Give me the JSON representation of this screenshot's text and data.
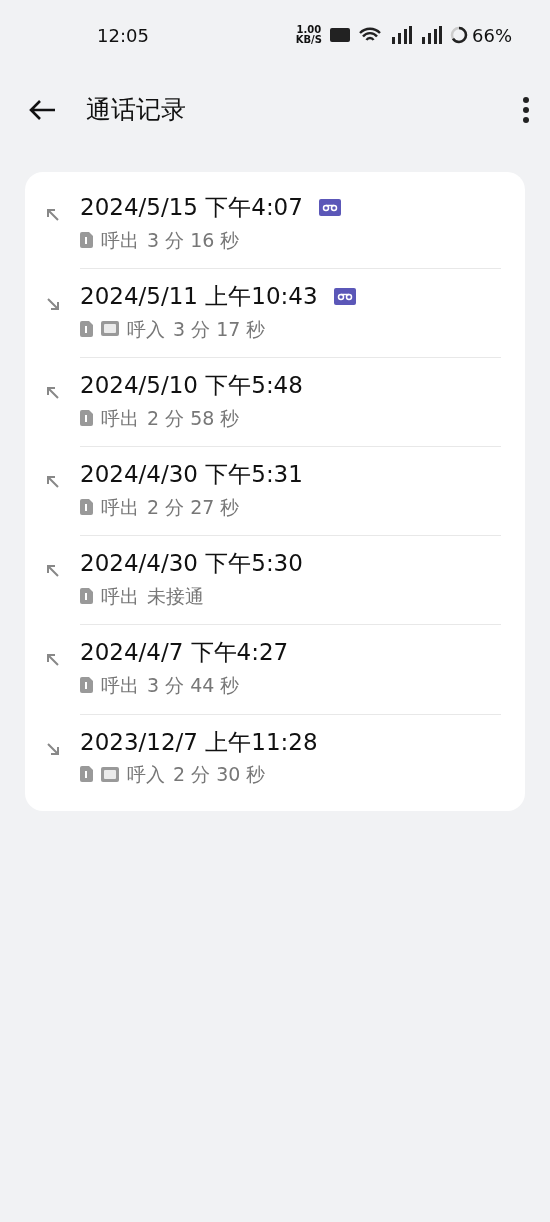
{
  "status_bar": {
    "time": "12:05",
    "speed": "1.00",
    "speed_unit": "KB/S",
    "battery": "66%"
  },
  "header": {
    "title": "通话记录"
  },
  "calls": [
    {
      "kind": "outgoing",
      "datetime": "2024/5/15 下午4:07",
      "recorded": true,
      "hd": false,
      "type": "呼出",
      "duration": "3 分 16 秒"
    },
    {
      "kind": "incoming",
      "datetime": "2024/5/11 上午10:43",
      "recorded": true,
      "hd": true,
      "type": "呼入",
      "duration": "3 分 17 秒"
    },
    {
      "kind": "outgoing",
      "datetime": "2024/5/10 下午5:48",
      "recorded": false,
      "hd": false,
      "type": "呼出",
      "duration": "2 分 58 秒"
    },
    {
      "kind": "outgoing",
      "datetime": "2024/4/30 下午5:31",
      "recorded": false,
      "hd": false,
      "type": "呼出",
      "duration": "2 分 27 秒"
    },
    {
      "kind": "outgoing",
      "datetime": "2024/4/30 下午5:30",
      "recorded": false,
      "hd": false,
      "type": "呼出",
      "duration": "未接通"
    },
    {
      "kind": "outgoing",
      "datetime": "2024/4/7 下午4:27",
      "recorded": false,
      "hd": false,
      "type": "呼出",
      "duration": "3 分 44 秒"
    },
    {
      "kind": "incoming",
      "datetime": "2023/12/7 上午11:28",
      "recorded": false,
      "hd": true,
      "type": "呼入",
      "duration": "2 分 30 秒"
    }
  ]
}
